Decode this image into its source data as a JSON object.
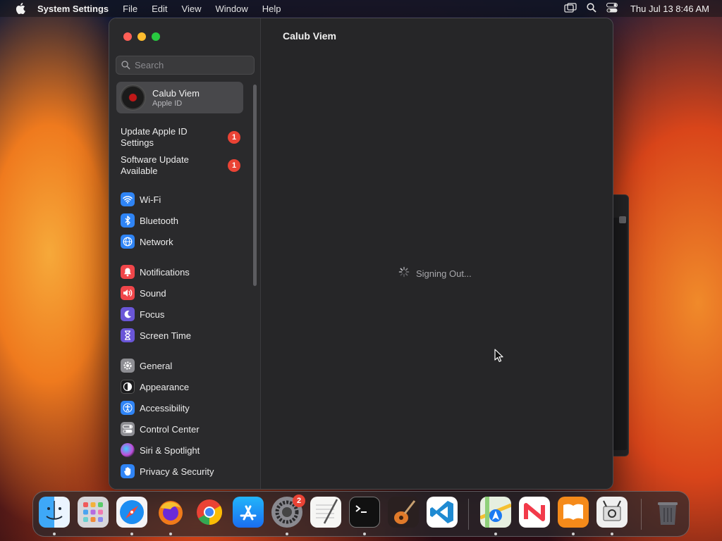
{
  "menubar": {
    "app_name": "System Settings",
    "menus": [
      "File",
      "Edit",
      "View",
      "Window",
      "Help"
    ],
    "clock": "Thu Jul 13  8:46 AM"
  },
  "window": {
    "search_placeholder": "Search",
    "account": {
      "name": "Calub Viem",
      "subtitle": "Apple ID"
    },
    "notices": [
      {
        "label": "Update Apple ID Settings",
        "badge": "1"
      },
      {
        "label": "Software Update Available",
        "badge": "1"
      }
    ],
    "nav": [
      {
        "label": "Wi-Fi",
        "icon": "wifi-icon",
        "color": "#2f84f5"
      },
      {
        "label": "Bluetooth",
        "icon": "bluetooth-icon",
        "color": "#2f84f5"
      },
      {
        "label": "Network",
        "icon": "network-globe-icon",
        "color": "#2f84f5"
      },
      {
        "label": "Notifications",
        "icon": "notifications-bell-icon",
        "color": "#f0464a"
      },
      {
        "label": "Sound",
        "icon": "sound-speaker-icon",
        "color": "#f0464a"
      },
      {
        "label": "Focus",
        "icon": "focus-moon-icon",
        "color": "#6a56d8"
      },
      {
        "label": "Screen Time",
        "icon": "screen-time-hourglass-icon",
        "color": "#6a56d8"
      },
      {
        "label": "General",
        "icon": "general-gear-icon",
        "color": "#8e8e93"
      },
      {
        "label": "Appearance",
        "icon": "appearance-icon",
        "color": "#1c1c1e"
      },
      {
        "label": "Accessibility",
        "icon": "accessibility-icon",
        "color": "#2f84f5"
      },
      {
        "label": "Control Center",
        "icon": "control-center-icon",
        "color": "#8e8e93"
      },
      {
        "label": "Siri & Spotlight",
        "icon": "siri-icon",
        "color": "#c04cd8"
      },
      {
        "label": "Privacy & Security",
        "icon": "privacy-hand-icon",
        "color": "#2f84f5"
      }
    ],
    "content_title": "Calub Viem",
    "status_text": "Signing Out..."
  },
  "dock": {
    "apps": [
      "Finder",
      "Launchpad",
      "Safari",
      "Firefox",
      "Chrome",
      "App Store",
      "System Settings",
      "TextEdit",
      "Terminal",
      "GarageBand",
      "Visual Studio Code",
      "Maps",
      "News",
      "Books",
      "Preview",
      "Trash"
    ],
    "settings_badge": "2"
  }
}
